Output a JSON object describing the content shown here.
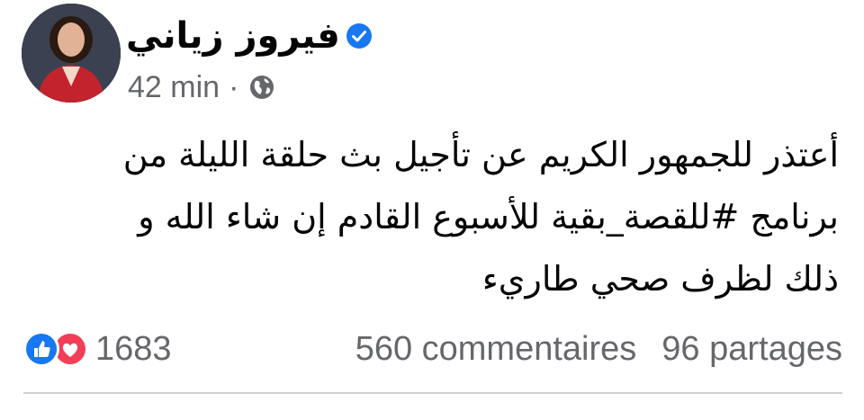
{
  "author": {
    "name": "فيروز زياني",
    "verified_icon": "verified-badge-icon",
    "avatar_icon": "profile-photo"
  },
  "meta": {
    "time": "42 min",
    "separator": "·",
    "privacy_icon": "globe-icon"
  },
  "post": {
    "lines": [
      "أعتذر للجمهور الكريم عن تأجيل بث حلقة الليلة من",
      "برنامج #للقصة_بقية  للأسبوع القادم إن شاء الله و",
      "ذلك لظرف صحي طاريء"
    ]
  },
  "stats": {
    "reactions_count": "1683",
    "comments": "560 commentaires",
    "shares": "96 partages",
    "reaction_icons": [
      "like-icon",
      "love-icon"
    ]
  },
  "colors": {
    "text": "#050505",
    "secondary": "#65676b",
    "facebook_blue": "#1877f2",
    "love_red": "#f33e58",
    "divider": "#ced0d4"
  }
}
